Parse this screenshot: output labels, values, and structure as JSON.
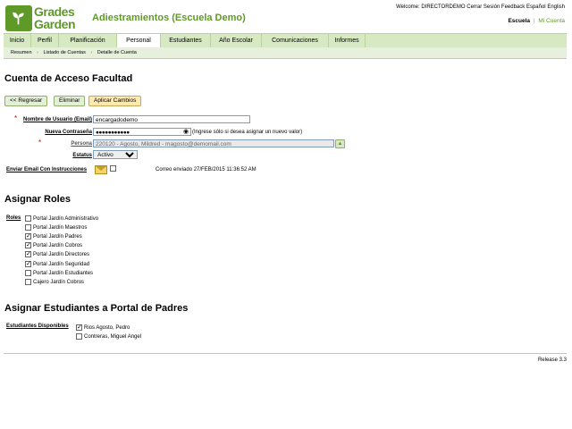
{
  "header": {
    "logo_line1": "Grades",
    "logo_line2": "Garden",
    "app_title": "Adiestramientos (Escuela Demo)",
    "top_links": [
      "Welcome: DIRECTORDEMO",
      "Cerrar Sesión",
      "Feedback",
      "Español",
      "English"
    ],
    "context_school": "Escuela",
    "context_sep": "|",
    "context_account": "Mi Cuenta"
  },
  "tabs": [
    "Inicio",
    "Perfil",
    "Planificación",
    "Personal",
    "Estudiantes",
    "Año Escolar",
    "Comunicaciones",
    "Informes"
  ],
  "active_tab": "Personal",
  "breadcrumb": [
    "Resumen",
    "Listado de Cuentas",
    "Detalle de Cuenta"
  ],
  "page_title": "Cuenta de Acceso Facultad",
  "buttons": {
    "back": "<< Regresar",
    "delete": "Eliminar",
    "apply": "Aplicar Cambios"
  },
  "form": {
    "username_label": "Nombre de Usuario (Email)",
    "username_value": "encargadodemo",
    "password_label": "Nueva Contraseña",
    "password_value": "●●●●●●●●●●●",
    "password_hint": "(Ingrese sólo si desea asignar un nuevo valor)",
    "person_label": "Persona",
    "person_value": "220120 - Agosto, Mildred - magosto@demomail.com",
    "status_label": "Estatus",
    "status_value": "Activo",
    "email_label": "Enviar Email Con Instrucciones",
    "email_sent": "Correo enviado 27/FEB/2015 11:36:52 AM"
  },
  "roles_section": {
    "title": "Asignar Roles",
    "label": "Roles",
    "items": [
      {
        "label": "Portal Jardín Administrativo",
        "checked": false
      },
      {
        "label": "Portal Jardín Maestros",
        "checked": false
      },
      {
        "label": "Portal Jardín Padres",
        "checked": true
      },
      {
        "label": "Portal Jardín Cobros",
        "checked": true
      },
      {
        "label": "Portal Jardín Directores",
        "checked": true
      },
      {
        "label": "Portal Jardín Seguridad",
        "checked": true
      },
      {
        "label": "Portal Jardín Estudiantes",
        "checked": false
      },
      {
        "label": "Cajero Jardín Cobros",
        "checked": false
      }
    ]
  },
  "students_section": {
    "title": "Asignar Estudiantes a Portal de Padres",
    "label": "Estudiantes Disponibles",
    "items": [
      {
        "label": "Rios Agosto, Pedro",
        "checked": true
      },
      {
        "label": "Contreras, Miguel Angel",
        "checked": false
      }
    ]
  },
  "footer": {
    "release": "Release 3.3"
  },
  "colors": {
    "brand_green": "#5f9a28",
    "tab_bg": "#d7e9c2",
    "apply_bg": "#fde9b2"
  }
}
